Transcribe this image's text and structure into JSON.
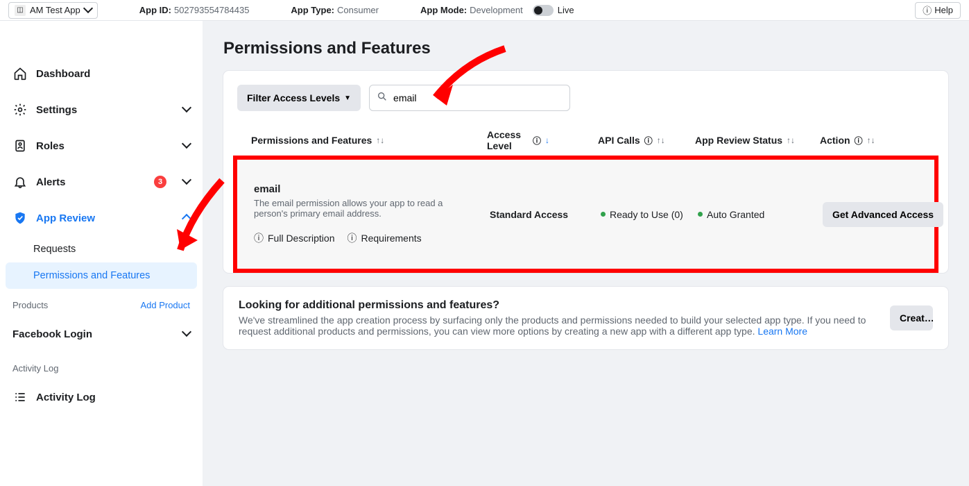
{
  "topbar": {
    "app_name": "AM Test App",
    "app_id_label": "App ID:",
    "app_id_value": "502793554784435",
    "app_type_label": "App Type:",
    "app_type_value": "Consumer",
    "app_mode_label": "App Mode:",
    "app_mode_value": "Development",
    "mode_live": "Live",
    "help": "Help"
  },
  "sidebar": {
    "dashboard": "Dashboard",
    "settings": "Settings",
    "roles": "Roles",
    "alerts": "Alerts",
    "alerts_count": "3",
    "app_review": "App Review",
    "requests": "Requests",
    "permissions": "Permissions and Features",
    "products_label": "Products",
    "add_product": "Add Product",
    "facebook_login": "Facebook Login",
    "activity_log_label": "Activity Log",
    "activity_log": "Activity Log"
  },
  "main": {
    "heading": "Permissions and Features",
    "filter_btn": "Filter Access Levels",
    "search_value": "email",
    "columns": {
      "permissions": "Permissions and Features",
      "access_level": "Access Level",
      "api_calls": "API Calls",
      "review_status": "App Review Status",
      "action": "Action"
    },
    "row": {
      "title": "email",
      "description": "The email permission allows your app to read a person's primary email address.",
      "full_desc": "Full Description",
      "requirements": "Requirements",
      "access_level": "Standard Access",
      "api_calls": "Ready to Use (0)",
      "review_status": "Auto Granted",
      "action": "Get Advanced Access"
    },
    "info": {
      "title": "Looking for additional permissions and features?",
      "body": "We've streamlined the app creation process by surfacing only the products and permissions needed to build your selected app type. If you need to request additional products and permissions, you can view more options by creating a new app with a different app type. ",
      "learn_more": "Learn More",
      "create_btn": "Creat…"
    }
  }
}
